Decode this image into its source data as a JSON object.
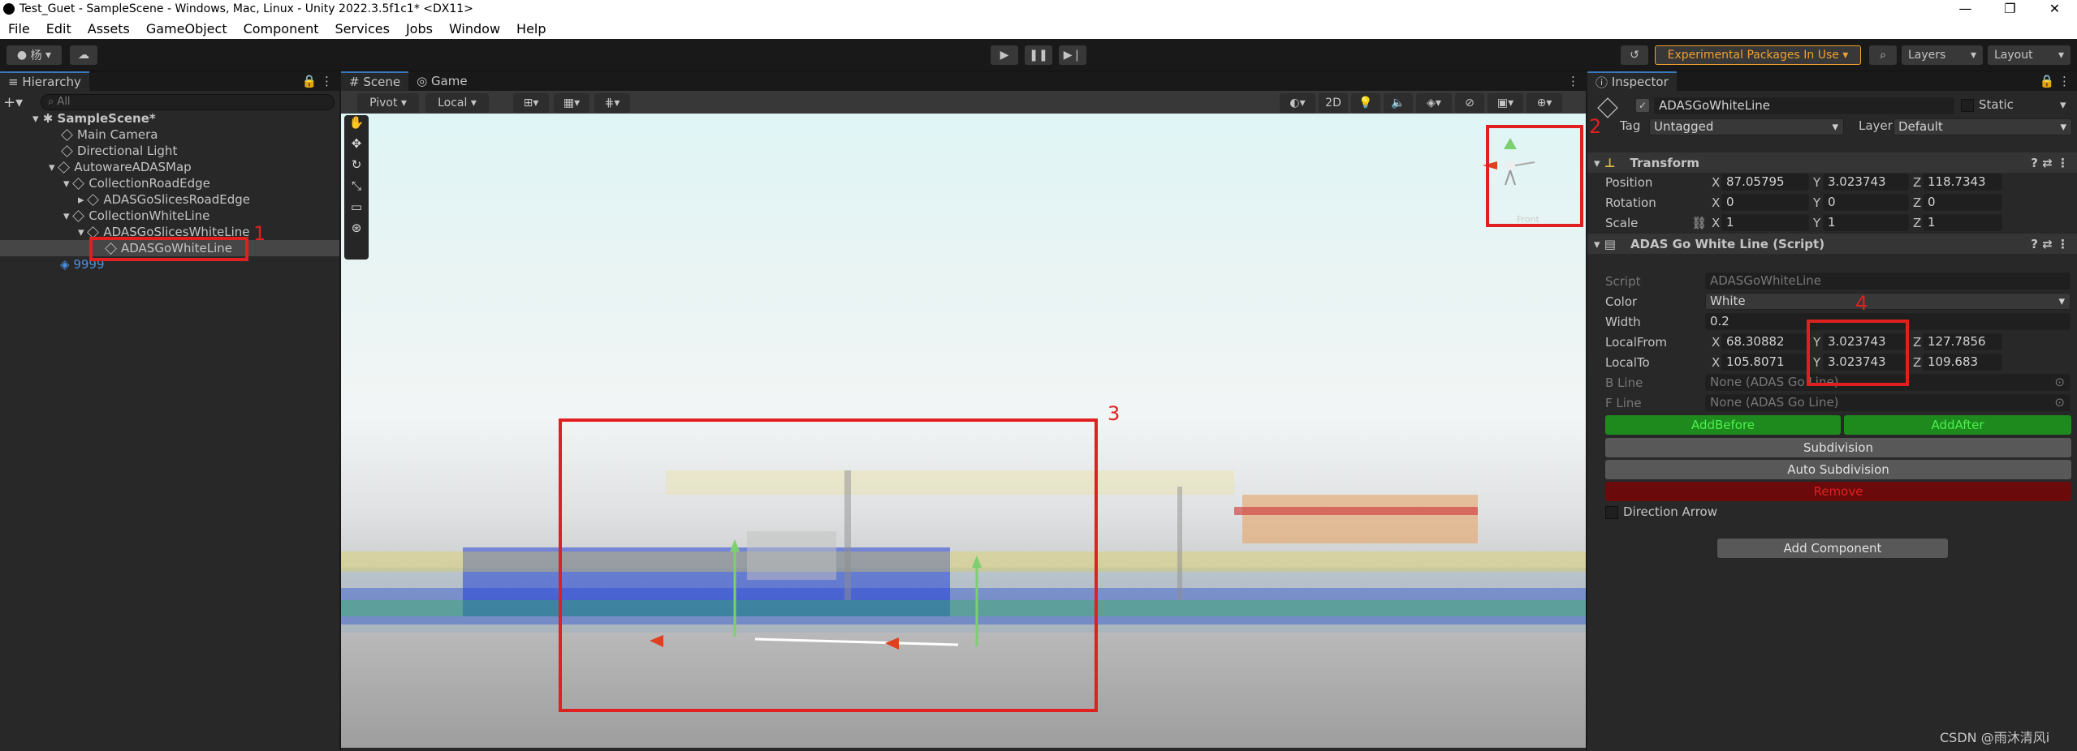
{
  "window": {
    "title": "Test_Guet - SampleScene - Windows, Mac, Linux - Unity 2022.3.5f1c1* <DX11>"
  },
  "menu": [
    "File",
    "Edit",
    "Assets",
    "GameObject",
    "Component",
    "Services",
    "Jobs",
    "Window",
    "Help"
  ],
  "toolbar": {
    "account": "杨",
    "experimental": "Experimental Packages In Use",
    "layers": "Layers",
    "layout": "Layout"
  },
  "hierarchy": {
    "tab": "Hierarchy",
    "search_placeholder": "All",
    "items": [
      "SampleScene*",
      "Main Camera",
      "Directional Light",
      "AutowareADASMap",
      "CollectionRoadEdge",
      "ADASGoSlicesRoadEdge",
      "CollectionWhiteLine",
      "ADASGoSlicesWhiteLine",
      "ADASGoWhiteLine",
      "9999"
    ]
  },
  "scene": {
    "tabs": [
      "Scene",
      "Game"
    ],
    "pivot": "Pivot",
    "local": "Local",
    "mode2d": "2D",
    "gizmo_label": "Front"
  },
  "inspector": {
    "tab": "Inspector",
    "object_name": "ADASGoWhiteLine",
    "static": "Static",
    "tag_label": "Tag",
    "tag_value": "Untagged",
    "layer_label": "Layer",
    "layer_value": "Default",
    "transform": {
      "title": "Transform",
      "rows": [
        {
          "label": "Position",
          "x": "87.05795",
          "y": "3.023743",
          "z": "118.7343"
        },
        {
          "label": "Rotation",
          "x": "0",
          "y": "0",
          "z": "0"
        },
        {
          "label": "Scale",
          "x": "1",
          "y": "1",
          "z": "1"
        }
      ]
    },
    "script": {
      "title": "ADAS Go White Line (Script)",
      "script_label": "Script",
      "script_value": "ADASGoWhiteLine",
      "color_label": "Color",
      "color_value": "White",
      "width_label": "Width",
      "width_value": "0.2",
      "local_from": {
        "label": "LocalFrom",
        "x": "68.30882",
        "y": "3.023743",
        "z": "127.7856"
      },
      "local_to": {
        "label": "LocalTo",
        "x": "105.8071",
        "y": "3.023743",
        "z": "109.683"
      },
      "b_line": "B Line",
      "b_line_value": "None (ADAS Go Line)",
      "f_line": "F Line",
      "f_line_value": "None (ADAS Go Line)",
      "add_before": "AddBefore",
      "add_after": "AddAfter",
      "subdivision": "Subdivision",
      "auto_subdivision": "Auto Subdivision",
      "remove": "Remove",
      "direction_arrow": "Direction Arrow"
    },
    "add_component": "Add Component"
  },
  "annotations": [
    "1",
    "2",
    "3",
    "4"
  ],
  "watermark": "CSDN @雨沐清风i",
  "axes": {
    "x": "X",
    "y": "Y",
    "z": "Z"
  }
}
